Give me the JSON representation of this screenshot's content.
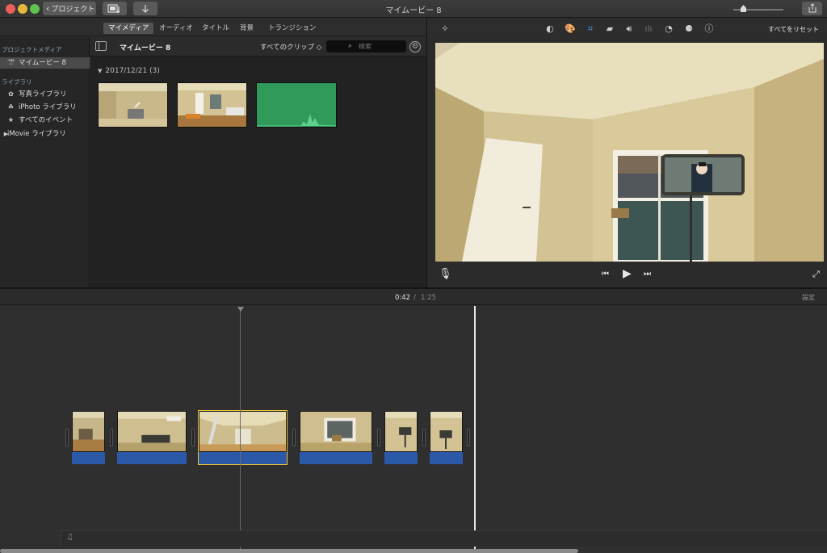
{
  "window": {
    "title": "マイムービー 8",
    "projects_label": "プロジェクト"
  },
  "tabs": [
    {
      "label": "マイメディア",
      "active": true
    },
    {
      "label": "オーディオ",
      "active": false
    },
    {
      "label": "タイトル",
      "active": false
    },
    {
      "label": "背景",
      "active": false
    },
    {
      "label": "トランジション",
      "active": false
    }
  ],
  "sidebar": {
    "project_media_header": "プロジェクトメディア",
    "project_item": "マイムービー 8",
    "library_header": "ライブラリ",
    "items": [
      {
        "label": "写真ライブラリ",
        "icon": "photos-icon"
      },
      {
        "label": "iPhoto ライブラリ",
        "icon": "iphoto-icon"
      },
      {
        "label": "すべてのイベント",
        "icon": "star-icon"
      },
      {
        "label": "iMovie ライブラリ",
        "icon": "disclosure-icon"
      }
    ]
  },
  "browser": {
    "title": "マイムービー 8",
    "clip_filter": "すべてのクリップ ◇",
    "search_placeholder": "検索",
    "date_group": "2017/12/21",
    "date_count": "(3)"
  },
  "viewer": {
    "reset_all": "すべてをリセット"
  },
  "timeline": {
    "current_time": "0:42",
    "separator": "/",
    "total_time": "1:25",
    "settings_label": "設定",
    "zoom_level": 0.15
  },
  "colors": {
    "audio_track": "#2c58a8",
    "selected_outline": "#f0c43a",
    "green_clip": "#2f9a5a"
  }
}
